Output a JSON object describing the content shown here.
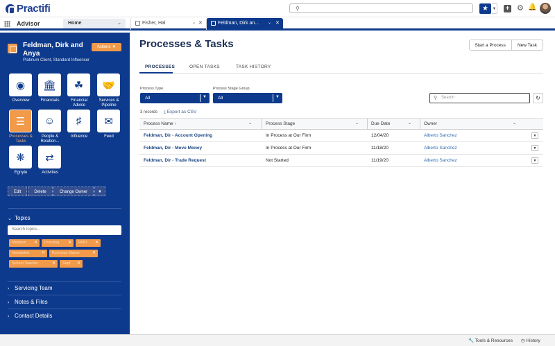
{
  "app": {
    "logo_text": "Practifi",
    "app_name": "Advisor",
    "home_select": "Home"
  },
  "tabs": [
    {
      "label": "Fisher, Hal"
    },
    {
      "label": "Feldman, Dirk an..."
    }
  ],
  "account": {
    "name": "Feldman, Dirk and Anya",
    "subtitle": "Platinum Client, Standard Influencer",
    "actions_label": "Actions"
  },
  "tiles": [
    {
      "label": "Overview",
      "icon": "eye-icon"
    },
    {
      "label": "Financials",
      "icon": "bank-icon"
    },
    {
      "label": "Financial Advice",
      "icon": "piggy-bank-icon"
    },
    {
      "label": "Services & Pipeline",
      "icon": "handshake-icon"
    },
    {
      "label": "Processes & Tasks",
      "icon": "org-chart-icon"
    },
    {
      "label": "People & Relation...",
      "icon": "people-icon"
    },
    {
      "label": "Influence",
      "icon": "binoculars-icon"
    },
    {
      "label": "Feed",
      "icon": "chat-icon"
    },
    {
      "label": "Egnyte",
      "icon": "egnyte-icon"
    },
    {
      "label": "Activities",
      "icon": "arrows-icon"
    }
  ],
  "record_buttons": {
    "edit": "Edit",
    "delete": "Delete",
    "change_owner": "Change Owner"
  },
  "topics": {
    "header": "Topics",
    "search_placeholder": "Search topics...",
    "chips": [
      "Madison",
      "Pressing",
      "RMD",
      "Newsletter",
      "Business Owner",
      "School Teacher",
      "Sept"
    ]
  },
  "sections": {
    "servicing": "Servicing Team",
    "notes": "Notes & Files",
    "contact": "Contact Details"
  },
  "page": {
    "title": "Processes & Tasks",
    "start_process": "Start a Process",
    "new_task": "New Task",
    "tabs": [
      "PROCESSES",
      "OPEN TASKS",
      "TASK HISTORY"
    ]
  },
  "filters": {
    "type_label": "Process Type",
    "type_value": "All",
    "group_label": "Process Stage Group",
    "group_value": "All",
    "search_placeholder": "Search"
  },
  "table": {
    "record_count": "3 records",
    "export_label": "Export as CSV",
    "columns": [
      "Process Name",
      "Process Stage",
      "Due Date",
      "Owner"
    ],
    "sort_indicator": "↑",
    "rows": [
      {
        "name": "Feldman, Dir - Account Opening",
        "stage": "In Process at Our Firm",
        "due": "12/04/20",
        "owner": "Alberto Sanchez"
      },
      {
        "name": "Feldman, Dir - Move Money",
        "stage": "In Process at Our Firm",
        "due": "11/18/20",
        "owner": "Alberto Sanchez"
      },
      {
        "name": "Feldman, Dir - Trade Request",
        "stage": "Not Started",
        "due": "11/19/20",
        "owner": "Alberto Sanchez"
      }
    ]
  },
  "footer": {
    "tools": "Tools & Resources",
    "history": "History"
  },
  "colors": {
    "brand": "#0d3a8c",
    "accent": "#f19a4a"
  }
}
